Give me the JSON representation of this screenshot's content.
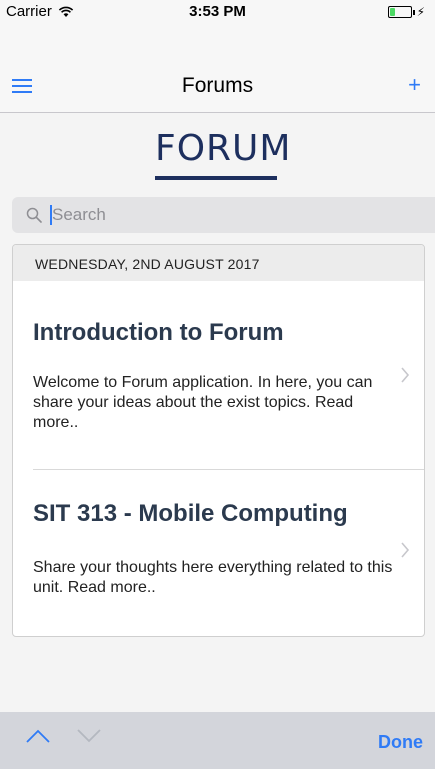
{
  "status_bar": {
    "carrier": "Carrier",
    "time": "3:53 PM",
    "battery_level": 0.25,
    "battery_color": "#4cd964"
  },
  "nav": {
    "title": "Forums",
    "menu_icon": "hamburger-menu-icon",
    "add_label": "+"
  },
  "logo": {
    "text": "FORUM"
  },
  "search": {
    "placeholder": "Search",
    "icon": "search-icon"
  },
  "feed": {
    "date_header": "WEDNESDAY, 2ND AUGUST 2017",
    "topics": [
      {
        "title": "Introduction to Forum",
        "description": "Welcome to Forum application. In here, you can share your ideas about the exist topics. Read more.."
      },
      {
        "title": "SIT 313 - Mobile Computing",
        "description": "Share your thoughts here everything related to this unit. Read more.."
      }
    ]
  },
  "toolbar": {
    "done_label": "Done",
    "up_icon": "chevron-up-icon",
    "down_icon": "chevron-down-icon"
  },
  "colors": {
    "accent": "#2f7bf6",
    "title_text": "#2b3a4e",
    "logo": "#1d2f5e"
  }
}
